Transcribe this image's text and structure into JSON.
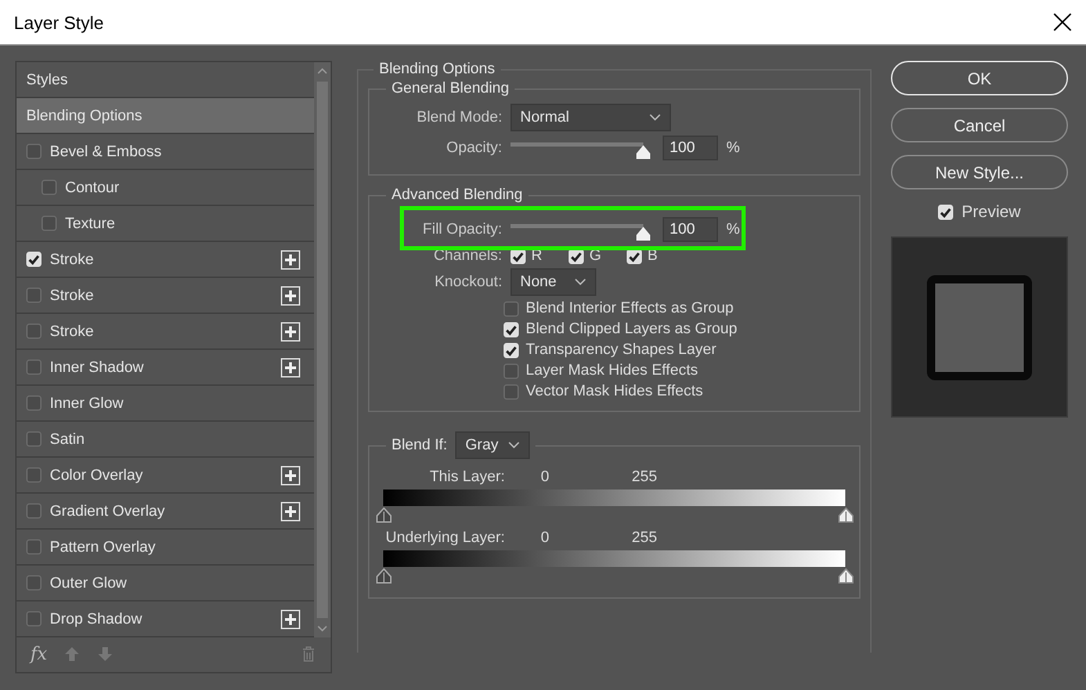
{
  "window": {
    "title": "Layer Style"
  },
  "styles_list": [
    {
      "label": "Styles",
      "kind": "header",
      "selected": false
    },
    {
      "label": "Blending Options",
      "kind": "header",
      "selected": true
    },
    {
      "label": "Bevel & Emboss",
      "kind": "effect",
      "checked": false,
      "selected": false,
      "add": false,
      "children": [
        {
          "label": "Contour",
          "kind": "effect",
          "checked": false,
          "selected": false,
          "add": false
        },
        {
          "label": "Texture",
          "kind": "effect",
          "checked": false,
          "selected": false,
          "add": false
        }
      ]
    },
    {
      "label": "Stroke",
      "kind": "effect",
      "checked": true,
      "selected": false,
      "add": true
    },
    {
      "label": "Stroke",
      "kind": "effect",
      "checked": false,
      "selected": false,
      "add": true
    },
    {
      "label": "Stroke",
      "kind": "effect",
      "checked": false,
      "selected": false,
      "add": true
    },
    {
      "label": "Inner Shadow",
      "kind": "effect",
      "checked": false,
      "selected": false,
      "add": true
    },
    {
      "label": "Inner Glow",
      "kind": "effect",
      "checked": false,
      "selected": false,
      "add": false
    },
    {
      "label": "Satin",
      "kind": "effect",
      "checked": false,
      "selected": false,
      "add": false
    },
    {
      "label": "Color Overlay",
      "kind": "effect",
      "checked": false,
      "selected": false,
      "add": true
    },
    {
      "label": "Gradient Overlay",
      "kind": "effect",
      "checked": false,
      "selected": false,
      "add": true
    },
    {
      "label": "Pattern Overlay",
      "kind": "effect",
      "checked": false,
      "selected": false,
      "add": false
    },
    {
      "label": "Outer Glow",
      "kind": "effect",
      "checked": false,
      "selected": false,
      "add": false
    },
    {
      "label": "Drop Shadow",
      "kind": "effect",
      "checked": false,
      "selected": false,
      "add": true
    }
  ],
  "styles_footer": {
    "fx": "fx"
  },
  "blending_options": {
    "title": "Blending Options",
    "general": {
      "title": "General Blending",
      "blend_mode": {
        "label": "Blend Mode:",
        "value": "Normal"
      },
      "opacity": {
        "label": "Opacity:",
        "level": 1,
        "value": "100",
        "unit": "%"
      }
    },
    "advanced": {
      "title": "Advanced Blending",
      "fill_opacity": {
        "label": "Fill Opacity:",
        "level": 1,
        "value": "100",
        "unit": "%",
        "highlighted": true
      },
      "channels": {
        "label": "Channels:",
        "items": [
          {
            "label": "R",
            "checked": true
          },
          {
            "label": "G",
            "checked": true
          },
          {
            "label": "B",
            "checked": true
          }
        ]
      },
      "knockout": {
        "label": "Knockout:",
        "value": "None"
      },
      "options": [
        {
          "label": "Blend Interior Effects as Group",
          "checked": false
        },
        {
          "label": "Blend Clipped Layers as Group",
          "checked": true
        },
        {
          "label": "Transparency Shapes Layer",
          "checked": true
        },
        {
          "label": "Layer Mask Hides Effects",
          "checked": false
        },
        {
          "label": "Vector Mask Hides Effects",
          "checked": false
        }
      ]
    },
    "blend_if": {
      "label": "Blend If:",
      "value": "Gray",
      "ranges": [
        {
          "label": "This Layer:",
          "low": "0",
          "high": "255",
          "thumbs": [
            {
              "level": 0
            },
            {
              "level": 1
            }
          ]
        },
        {
          "label": "Underlying Layer:",
          "low": "0",
          "high": "255",
          "thumbs": [
            {
              "level": 0
            },
            {
              "level": 1
            }
          ]
        }
      ]
    }
  },
  "buttons": [
    {
      "label": "OK",
      "default": true
    },
    {
      "label": "Cancel",
      "default": false
    },
    {
      "label": "New Style...",
      "default": false
    }
  ],
  "preview": {
    "label": "Preview",
    "checked": true
  }
}
